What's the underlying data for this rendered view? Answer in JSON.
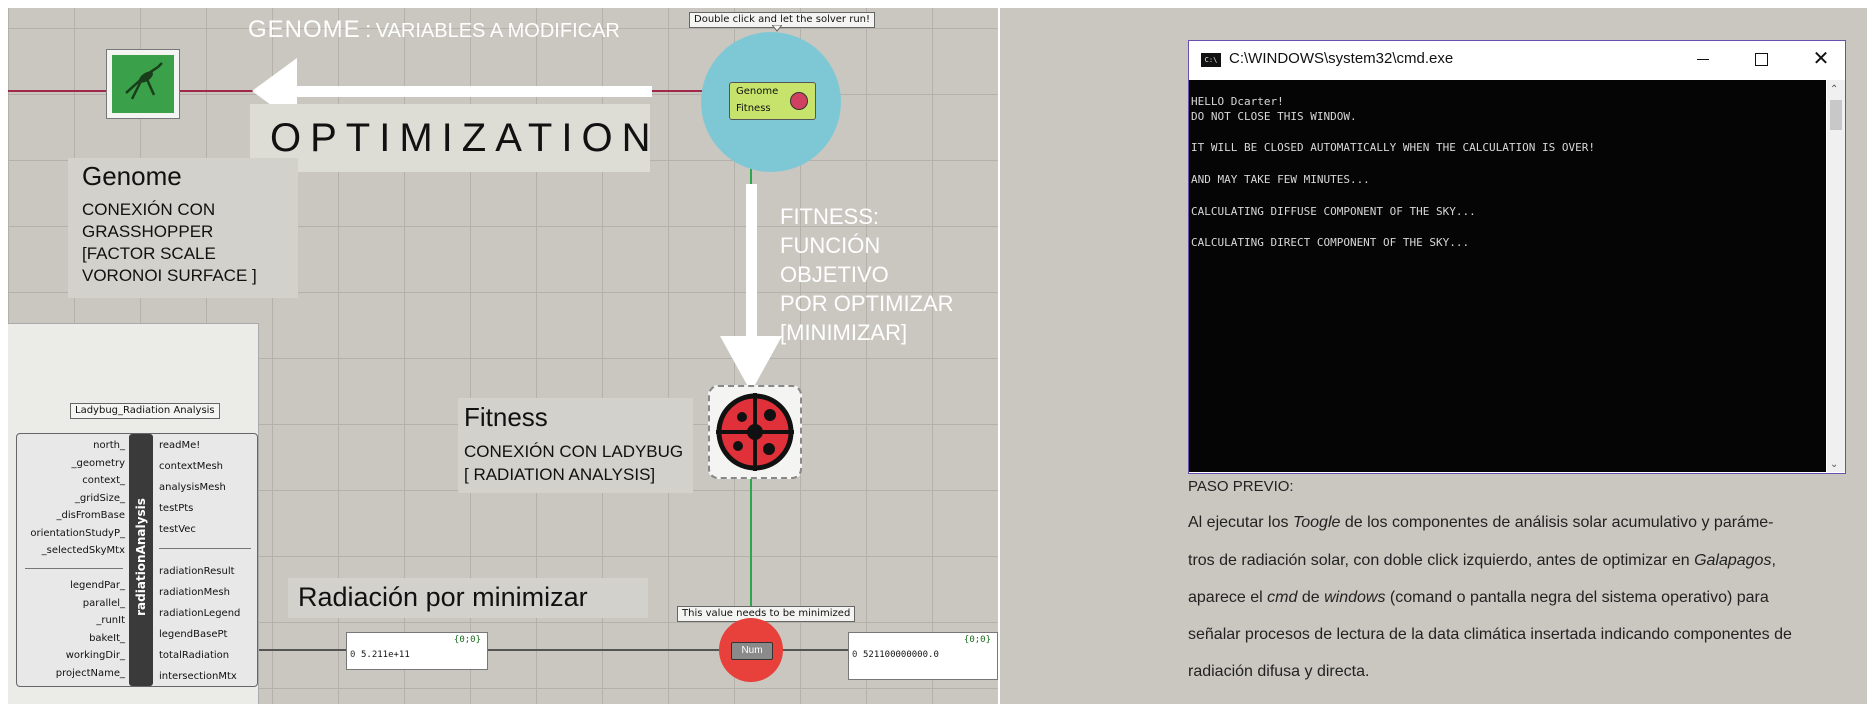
{
  "canvas": {
    "genome_banner": {
      "title": "GENOME",
      "separator": ":",
      "subtitle": "VARIABLES A MODIFICAR"
    },
    "optimization_label": "OPTIMIZATION",
    "solver_tooltip": "Double click and let the solver run!",
    "galapagos_ports": {
      "genome": "Genome",
      "fitness": "Fitness"
    },
    "genome_block": {
      "title": "Genome",
      "lines": [
        "CONEXIÓN CON",
        "GRASSHOPPER",
        "[FACTOR SCALE",
        "VORONOI SURFACE ]"
      ]
    },
    "fitness_block": {
      "lines": [
        "FITNESS:",
        "FUNCIÓN",
        "OBJETIVO",
        "POR OPTIMIZAR",
        "[MINIMIZAR]"
      ]
    },
    "fitness_ladybug": {
      "title": "Fitness",
      "lines": [
        "CONEXIÓN CON LADYBUG",
        "[ RADIATION ANALYSIS]"
      ]
    },
    "radiation_label": "Radiación por minimizar",
    "minimize_tooltip": "This value needs to be minimized",
    "num_label": "Num",
    "component": {
      "tooltip": "Ladybug_Radiation Analysis",
      "name": "radiationAnalysis",
      "inputs": [
        "north_",
        "_geometry",
        "context_",
        "_gridSize_",
        "_disFromBase",
        "orientationStudyP_",
        "_selectedSkyMtx",
        "",
        "legendPar_",
        "parallel_",
        "_runIt",
        "bakeIt_",
        "workingDir_",
        "projectName_"
      ],
      "outputs": [
        "readMe!",
        "contextMesh",
        "analysisMesh",
        "testPts",
        "testVec",
        "",
        "radiationResult",
        "radiationMesh",
        "radiationLegend",
        "legendBasePt",
        "totalRadiation",
        "intersectionMtx"
      ]
    },
    "panel1": {
      "path": "{0;0}",
      "index": "0",
      "value": "5.211e+11"
    },
    "panel2": {
      "path": "{0;0}",
      "index": "0",
      "value": "521100000000.0"
    }
  },
  "cmd": {
    "title": "C:\\WINDOWS\\system32\\cmd.exe",
    "icon_text": "C:\\",
    "lines": [
      "HELLO Dcarter!",
      "DO NOT CLOSE THIS WINDOW.",
      "",
      "IT WILL BE CLOSED AUTOMATICALLY WHEN THE CALCULATION IS OVER!",
      "",
      "AND MAY TAKE FEW MINUTES...",
      "",
      "CALCULATING DIFFUSE COMPONENT OF THE SKY...",
      "",
      "CALCULATING DIRECT COMPONENT OF THE SKY..."
    ]
  },
  "paragraph": {
    "heading": "PASO PREVIO:",
    "l1a": "Al ejecutar los ",
    "l1b": "Toogle",
    "l1c": " de los componentes de análisis solar acumulativo y paráme-",
    "l2a": "tros de radiación solar, con doble click izquierdo, antes de optimizar en ",
    "l2b": "Galapagos",
    "l2c": ",",
    "l3a": "aparece el ",
    "l3b": "cmd",
    "l3c": " de ",
    "l3d": "windows",
    "l3e": " (comand o pantalla negra del sistema operativo) para",
    "l4": "señalar procesos de lectura de la data climática insertada indicando componentes de",
    "l5": "radiación difusa y directa."
  },
  "colors": {
    "canvas": "#c9c7c0",
    "wire_green": "#2aa84a",
    "wire_red": "#a0284a",
    "galapagos_circle": "#7ec8d6",
    "minimize_circle": "#e8403a",
    "cmd_border": "#6a4fb0"
  }
}
